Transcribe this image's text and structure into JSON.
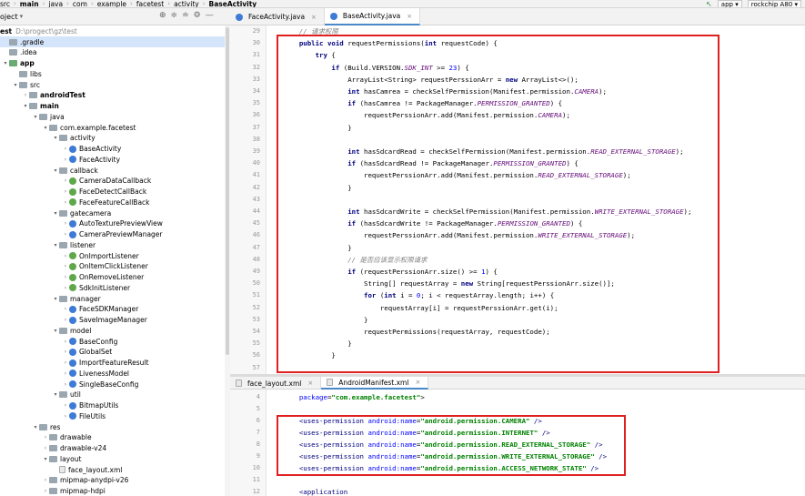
{
  "breadcrumb": [
    "src",
    "main",
    "java",
    "com",
    "example",
    "facetest",
    "activity",
    "BaseActivity"
  ],
  "toolbar": {
    "run_config": "app",
    "device": "rockchip A80"
  },
  "project": {
    "label": "oject",
    "root_name": "est",
    "root_path": "D:\\progect\\gz\\test"
  },
  "tree": [
    {
      "depth": 0,
      "arrow": "",
      "icon": "folder",
      "label": ".gradle",
      "sel": true
    },
    {
      "depth": 0,
      "arrow": "",
      "icon": "folder",
      "label": ".idea"
    },
    {
      "depth": 0,
      "arrow": "▾",
      "icon": "green",
      "label": "app",
      "bold": true
    },
    {
      "depth": 1,
      "arrow": "",
      "icon": "folder",
      "label": "libs"
    },
    {
      "depth": 1,
      "arrow": "▾",
      "icon": "folder",
      "label": "src"
    },
    {
      "depth": 2,
      "arrow": "›",
      "icon": "folder",
      "label": "androidTest",
      "bold": true
    },
    {
      "depth": 2,
      "arrow": "▾",
      "icon": "folder",
      "label": "main",
      "bold": true
    },
    {
      "depth": 3,
      "arrow": "▾",
      "icon": "folder",
      "label": "java"
    },
    {
      "depth": 4,
      "arrow": "▾",
      "icon": "pkg",
      "label": "com.example.facetest"
    },
    {
      "depth": 5,
      "arrow": "▾",
      "icon": "pkg",
      "label": "activity"
    },
    {
      "depth": 6,
      "arrow": "›",
      "icon": "cls",
      "label": "BaseActivity"
    },
    {
      "depth": 6,
      "arrow": "›",
      "icon": "cls",
      "label": "FaceActivity"
    },
    {
      "depth": 5,
      "arrow": "▾",
      "icon": "pkg",
      "label": "callback"
    },
    {
      "depth": 6,
      "arrow": "›",
      "icon": "intf",
      "label": "CameraDataCallback"
    },
    {
      "depth": 6,
      "arrow": "›",
      "icon": "intf",
      "label": "FaceDetectCallBack"
    },
    {
      "depth": 6,
      "arrow": "›",
      "icon": "intf",
      "label": "FaceFeatureCallBack"
    },
    {
      "depth": 5,
      "arrow": "▾",
      "icon": "pkg",
      "label": "gatecamera"
    },
    {
      "depth": 6,
      "arrow": "›",
      "icon": "cls",
      "label": "AutoTexturePreviewView"
    },
    {
      "depth": 6,
      "arrow": "›",
      "icon": "cls",
      "label": "CameraPreviewManager"
    },
    {
      "depth": 5,
      "arrow": "▾",
      "icon": "pkg",
      "label": "listener"
    },
    {
      "depth": 6,
      "arrow": "›",
      "icon": "intf",
      "label": "OnImportListener"
    },
    {
      "depth": 6,
      "arrow": "›",
      "icon": "intf",
      "label": "OnItemClickListener"
    },
    {
      "depth": 6,
      "arrow": "›",
      "icon": "intf",
      "label": "OnRemoveListener"
    },
    {
      "depth": 6,
      "arrow": "›",
      "icon": "intf",
      "label": "SdkInitListener"
    },
    {
      "depth": 5,
      "arrow": "▾",
      "icon": "pkg",
      "label": "manager"
    },
    {
      "depth": 6,
      "arrow": "›",
      "icon": "cls",
      "label": "FaceSDKManager"
    },
    {
      "depth": 6,
      "arrow": "›",
      "icon": "cls",
      "label": "SaveImageManager"
    },
    {
      "depth": 5,
      "arrow": "▾",
      "icon": "pkg",
      "label": "model"
    },
    {
      "depth": 6,
      "arrow": "›",
      "icon": "cls",
      "label": "BaseConfig"
    },
    {
      "depth": 6,
      "arrow": "›",
      "icon": "cls",
      "label": "GlobalSet"
    },
    {
      "depth": 6,
      "arrow": "›",
      "icon": "cls",
      "label": "ImportFeatureResult"
    },
    {
      "depth": 6,
      "arrow": "›",
      "icon": "cls",
      "label": "LivenessModel"
    },
    {
      "depth": 6,
      "arrow": "›",
      "icon": "cls",
      "label": "SingleBaseConfig"
    },
    {
      "depth": 5,
      "arrow": "▾",
      "icon": "pkg",
      "label": "util"
    },
    {
      "depth": 6,
      "arrow": "›",
      "icon": "cls",
      "label": "BitmapUtils"
    },
    {
      "depth": 6,
      "arrow": "›",
      "icon": "cls",
      "label": "FileUtils"
    },
    {
      "depth": 3,
      "arrow": "▾",
      "icon": "folder",
      "label": "res"
    },
    {
      "depth": 4,
      "arrow": "›",
      "icon": "folder",
      "label": "drawable"
    },
    {
      "depth": 4,
      "arrow": "›",
      "icon": "folder",
      "label": "drawable-v24"
    },
    {
      "depth": 4,
      "arrow": "▾",
      "icon": "folder",
      "label": "layout"
    },
    {
      "depth": 5,
      "arrow": "",
      "icon": "file",
      "label": "face_layout.xml"
    },
    {
      "depth": 4,
      "arrow": "›",
      "icon": "folder",
      "label": "mipmap-anydpi-v26"
    },
    {
      "depth": 4,
      "arrow": "›",
      "icon": "folder",
      "label": "mipmap-hdpi"
    }
  ],
  "tabs_top": [
    {
      "label": "FaceActivity.java",
      "active": false
    },
    {
      "label": "BaseActivity.java",
      "active": true
    }
  ],
  "tabs_bottom": [
    {
      "label": "face_layout.xml",
      "active": false
    },
    {
      "label": "AndroidManifest.xml",
      "active": true
    }
  ],
  "java_code": [
    {
      "n": "29",
      "t": [
        [
          "c",
          "    // 请求权限"
        ]
      ]
    },
    {
      "n": "30",
      "t": [
        [
          "p",
          "    "
        ],
        [
          "k",
          "public void "
        ],
        [
          "p",
          "requestPermissions("
        ],
        [
          "k",
          "int "
        ],
        [
          "p",
          "requestCode) {"
        ]
      ]
    },
    {
      "n": "31",
      "t": [
        [
          "p",
          "        "
        ],
        [
          "k",
          "try "
        ],
        [
          "p",
          "{"
        ]
      ]
    },
    {
      "n": "32",
      "t": [
        [
          "p",
          "            "
        ],
        [
          "k",
          "if "
        ],
        [
          "p",
          "(Build.VERSION."
        ],
        [
          "f",
          "SDK_INT"
        ],
        [
          "p",
          " >= "
        ],
        [
          "n",
          "23"
        ],
        [
          "p",
          ") {"
        ]
      ]
    },
    {
      "n": "33",
      "t": [
        [
          "p",
          "                ArrayList<String> requestPerssionArr = "
        ],
        [
          "k",
          "new "
        ],
        [
          "p",
          "ArrayList<>();"
        ]
      ]
    },
    {
      "n": "34",
      "t": [
        [
          "p",
          "                "
        ],
        [
          "k",
          "int "
        ],
        [
          "p",
          "hasCamrea = checkSelfPermission(Manifest.permission."
        ],
        [
          "f",
          "CAMERA"
        ],
        [
          "p",
          ");"
        ]
      ]
    },
    {
      "n": "35",
      "t": [
        [
          "p",
          "                "
        ],
        [
          "k",
          "if "
        ],
        [
          "p",
          "(hasCamrea != PackageManager."
        ],
        [
          "f",
          "PERMISSION_GRANTED"
        ],
        [
          "p",
          ") {"
        ]
      ]
    },
    {
      "n": "36",
      "t": [
        [
          "p",
          "                    requestPerssionArr.add(Manifest.permission."
        ],
        [
          "f",
          "CAMERA"
        ],
        [
          "p",
          ");"
        ]
      ]
    },
    {
      "n": "37",
      "t": [
        [
          "p",
          "                }"
        ]
      ]
    },
    {
      "n": "38",
      "t": [
        [
          "p",
          ""
        ]
      ]
    },
    {
      "n": "39",
      "t": [
        [
          "p",
          "                "
        ],
        [
          "k",
          "int "
        ],
        [
          "p",
          "hasSdcardRead = checkSelfPermission(Manifest.permission."
        ],
        [
          "f",
          "READ_EXTERNAL_STORAGE"
        ],
        [
          "p",
          ");"
        ]
      ]
    },
    {
      "n": "40",
      "t": [
        [
          "p",
          "                "
        ],
        [
          "k",
          "if "
        ],
        [
          "p",
          "(hasSdcardRead != PackageManager."
        ],
        [
          "f",
          "PERMISSION_GRANTED"
        ],
        [
          "p",
          ") {"
        ]
      ]
    },
    {
      "n": "41",
      "t": [
        [
          "p",
          "                    requestPerssionArr.add(Manifest.permission."
        ],
        [
          "f",
          "READ_EXTERNAL_STORAGE"
        ],
        [
          "p",
          ");"
        ]
      ]
    },
    {
      "n": "42",
      "t": [
        [
          "p",
          "                }"
        ]
      ]
    },
    {
      "n": "43",
      "t": [
        [
          "p",
          ""
        ]
      ]
    },
    {
      "n": "44",
      "t": [
        [
          "p",
          "                "
        ],
        [
          "k",
          "int "
        ],
        [
          "p",
          "hasSdcardWrite = checkSelfPermission(Manifest.permission."
        ],
        [
          "f",
          "WRITE_EXTERNAL_STORAGE"
        ],
        [
          "p",
          ");"
        ]
      ]
    },
    {
      "n": "45",
      "t": [
        [
          "p",
          "                "
        ],
        [
          "k",
          "if "
        ],
        [
          "p",
          "(hasSdcardWrite != PackageManager."
        ],
        [
          "f",
          "PERMISSION_GRANTED"
        ],
        [
          "p",
          ") {"
        ]
      ]
    },
    {
      "n": "46",
      "t": [
        [
          "p",
          "                    requestPerssionArr.add(Manifest.permission."
        ],
        [
          "f",
          "WRITE_EXTERNAL_STORAGE"
        ],
        [
          "p",
          ");"
        ]
      ]
    },
    {
      "n": "47",
      "t": [
        [
          "p",
          "                }"
        ]
      ]
    },
    {
      "n": "48",
      "t": [
        [
          "c",
          "                // 是否应该显示权限请求"
        ]
      ]
    },
    {
      "n": "49",
      "t": [
        [
          "p",
          "                "
        ],
        [
          "k",
          "if "
        ],
        [
          "p",
          "(requestPerssionArr.size() >= "
        ],
        [
          "n",
          "1"
        ],
        [
          "p",
          ") {"
        ]
      ]
    },
    {
      "n": "50",
      "t": [
        [
          "p",
          "                    String[] requestArray = "
        ],
        [
          "k",
          "new "
        ],
        [
          "p",
          "String[requestPerssionArr.size()];"
        ]
      ]
    },
    {
      "n": "51",
      "t": [
        [
          "p",
          "                    "
        ],
        [
          "k",
          "for "
        ],
        [
          "p",
          "("
        ],
        [
          "k",
          "int "
        ],
        [
          "p",
          "i = "
        ],
        [
          "n",
          "0"
        ],
        [
          "p",
          "; i < requestArray.length; i++) {"
        ]
      ]
    },
    {
      "n": "52",
      "t": [
        [
          "p",
          "                        requestArray[i] = requestPerssionArr.get(i);"
        ]
      ]
    },
    {
      "n": "53",
      "t": [
        [
          "p",
          "                    }"
        ]
      ]
    },
    {
      "n": "54",
      "t": [
        [
          "p",
          "                    requestPermissions(requestArray, requestCode);"
        ]
      ]
    },
    {
      "n": "55",
      "t": [
        [
          "p",
          "                }"
        ]
      ]
    },
    {
      "n": "56",
      "t": [
        [
          "p",
          "            }"
        ]
      ]
    },
    {
      "n": "57",
      "t": [
        [
          "p",
          ""
        ]
      ]
    }
  ],
  "xml_code": [
    {
      "n": "4",
      "t": [
        [
          "p",
          "    "
        ],
        [
          "attr",
          "package"
        ],
        [
          "p",
          "="
        ],
        [
          "val",
          "\"com.example.facetest\""
        ],
        [
          "p",
          ">"
        ]
      ]
    },
    {
      "n": "5",
      "t": [
        [
          "p",
          ""
        ]
      ]
    },
    {
      "n": "6",
      "t": [
        [
          "p",
          "    "
        ],
        [
          "tag",
          "<uses-permission "
        ],
        [
          "attr",
          "android:name"
        ],
        [
          "p",
          "="
        ],
        [
          "val",
          "\"android.permission.CAMERA\""
        ],
        [
          "tag",
          " />"
        ]
      ]
    },
    {
      "n": "7",
      "t": [
        [
          "p",
          "    "
        ],
        [
          "tag",
          "<uses-permission "
        ],
        [
          "attr",
          "android:name"
        ],
        [
          "p",
          "="
        ],
        [
          "val",
          "\"android.permission.INTERNET\""
        ],
        [
          "tag",
          " />"
        ]
      ]
    },
    {
      "n": "8",
      "t": [
        [
          "p",
          "    "
        ],
        [
          "tag",
          "<uses-permission "
        ],
        [
          "attr",
          "android:name"
        ],
        [
          "p",
          "="
        ],
        [
          "val",
          "\"android.permission.READ_EXTERNAL_STORAGE\""
        ],
        [
          "tag",
          " />"
        ]
      ]
    },
    {
      "n": "9",
      "t": [
        [
          "p",
          "    "
        ],
        [
          "tag",
          "<uses-permission "
        ],
        [
          "attr",
          "android:name"
        ],
        [
          "p",
          "="
        ],
        [
          "val",
          "\"android.permission.WRITE_EXTERNAL_STORAGE\""
        ],
        [
          "tag",
          " />"
        ]
      ]
    },
    {
      "n": "10",
      "t": [
        [
          "p",
          "    "
        ],
        [
          "tag",
          "<uses-permission "
        ],
        [
          "attr",
          "android:name"
        ],
        [
          "p",
          "="
        ],
        [
          "val",
          "\"android.permission.ACCESS_NETWORK_STATE\""
        ],
        [
          "tag",
          " />"
        ]
      ]
    },
    {
      "n": "11",
      "t": [
        [
          "p",
          ""
        ]
      ]
    },
    {
      "n": "12",
      "t": [
        [
          "p",
          "    "
        ],
        [
          "tag",
          "<application"
        ]
      ]
    }
  ]
}
